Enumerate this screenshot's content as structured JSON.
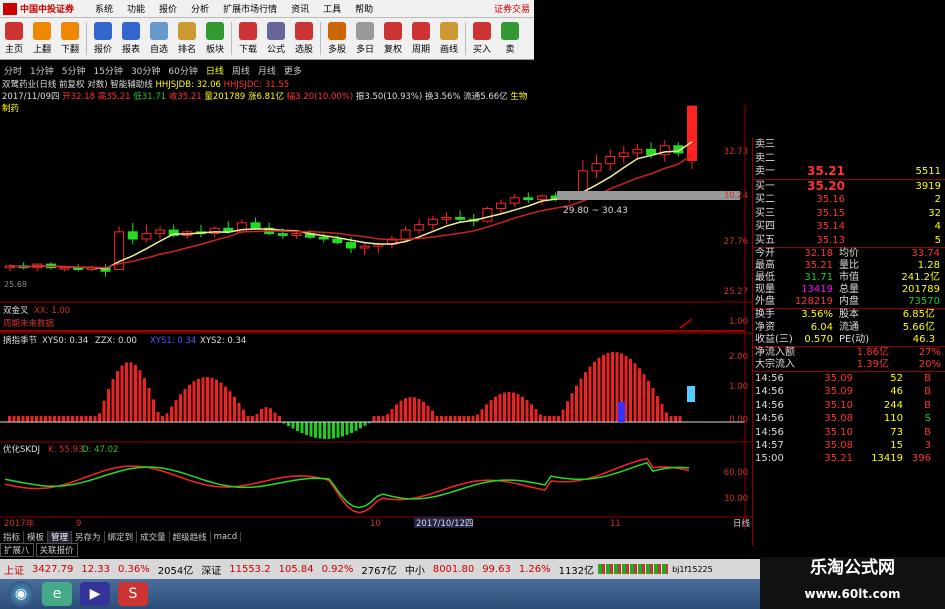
{
  "menu": {
    "brand": "中国中投证券",
    "items": [
      "系统",
      "功能",
      "报价",
      "分析",
      "扩展市场行情",
      "资讯",
      "工具",
      "帮助"
    ],
    "right": "证券交易"
  },
  "toolbar": [
    {
      "label": "主页",
      "icon": "home-icon",
      "color": "#c33"
    },
    {
      "label": "上翻",
      "icon": "up-arrow-icon",
      "color": "#e80"
    },
    {
      "label": "下翻",
      "icon": "down-arrow-icon",
      "color": "#e80"
    },
    {
      "label": "报价",
      "icon": "quote-icon",
      "color": "#36c"
    },
    {
      "label": "报表",
      "icon": "report-icon",
      "color": "#36c"
    },
    {
      "label": "自选",
      "icon": "f6-icon",
      "color": "#69c"
    },
    {
      "label": "排名",
      "icon": "rank-icon",
      "color": "#c93"
    },
    {
      "label": "板块",
      "icon": "sector-icon",
      "color": "#393"
    },
    {
      "label": "下载",
      "icon": "download-icon",
      "color": "#c33"
    },
    {
      "label": "公式",
      "icon": "formula-icon",
      "color": "#669"
    },
    {
      "label": "选股",
      "icon": "stock-pick-icon",
      "color": "#c33"
    },
    {
      "label": "多股",
      "icon": "multi-stock-icon",
      "color": "#c60"
    },
    {
      "label": "多日",
      "icon": "multi-day-icon",
      "color": "#999"
    },
    {
      "label": "复权",
      "icon": "adjust-icon",
      "color": "#c33"
    },
    {
      "label": "周期",
      "icon": "f8-icon",
      "color": "#c33"
    },
    {
      "label": "画线",
      "icon": "draw-icon",
      "color": "#c93"
    },
    {
      "label": "买入",
      "icon": "buy-icon",
      "color": "#c33"
    },
    {
      "label": "卖",
      "icon": "sell-icon",
      "color": "#393"
    }
  ],
  "periods": [
    "分时",
    "1分钟",
    "5分钟",
    "15分钟",
    "30分钟",
    "60分钟",
    "日线",
    "周线",
    "月线",
    "更多"
  ],
  "active_period": "日线",
  "info": {
    "line1_name": "双鹭药业(日线 前复权 对数)",
    "line1_ind": "智能辅助线",
    "line1_a": "HHJSJDB: 32.06",
    "line1_b": "HHJSJDC: 31.55",
    "date": "2017/11/09四",
    "open": "开32.18",
    "high": "高35.21",
    "low": "低31.71",
    "close": "收35.21",
    "vol": "量201789",
    "chg": "涨6.81亿",
    "pct": "幅3.20(10.00%)",
    "amp": "振3.50(10.93%)",
    "turn": "换3.56%",
    "flow": "流通5.66亿",
    "sector": "生物制药"
  },
  "chart": {
    "price_ticks": [
      "32.73",
      "30.24",
      "27.76",
      "25.27"
    ],
    "annotation_box": "29.80 ~ 30.43",
    "low_label": "25.68",
    "sub1": {
      "title": "双金叉",
      "label": "XX: 1.00",
      "note": "周期未来数据",
      "tick": "1.00"
    },
    "sub2": {
      "title": "摘指季节",
      "a": "XYS0: 0.34",
      "b": "ZZX: 0.00",
      "c": "XYS1: 0.34",
      "d": "XYS2: 0.34",
      "ticks": [
        "2.00",
        "1.00",
        "0.00"
      ]
    },
    "sub3": {
      "title": "优化SKDJ",
      "k": "K: 55.93",
      "d": "D: 47.02",
      "ticks": [
        "60.00",
        "30.00"
      ]
    },
    "xaxis": [
      "2017年",
      "9",
      "10",
      "2017/10/12四",
      "11"
    ],
    "period_label": "日线"
  },
  "side": {
    "asks": [
      {
        "label": "卖三",
        "price": "",
        "vol": ""
      },
      {
        "label": "卖二",
        "price": "",
        "vol": ""
      },
      {
        "label": "卖一",
        "price": "35.21",
        "vol": "5511"
      }
    ],
    "bids": [
      {
        "label": "买一",
        "price": "35.20",
        "vol": "3919"
      },
      {
        "label": "买二",
        "price": "35.16",
        "vol": "2"
      },
      {
        "label": "买三",
        "price": "35.15",
        "vol": "32"
      },
      {
        "label": "买四",
        "price": "35.14",
        "vol": "4"
      },
      {
        "label": "买五",
        "price": "35.13",
        "vol": "5"
      }
    ],
    "stats": [
      [
        "今开",
        "32.18",
        "均价",
        "33.74"
      ],
      [
        "最高",
        "35.21",
        "量比",
        "1.28"
      ],
      [
        "最低",
        "31.71",
        "市值",
        "241.2亿"
      ],
      [
        "现量",
        "13419",
        "总量",
        "201789"
      ],
      [
        "外盘",
        "128219",
        "内盘",
        "73570"
      ]
    ],
    "stats2": [
      [
        "换手",
        "3.56%",
        "股本",
        "6.85亿"
      ],
      [
        "净资",
        "6.04",
        "流通",
        "5.66亿"
      ],
      [
        "收益(三)",
        "0.570",
        "PE(动)",
        "46.3"
      ]
    ],
    "flows": [
      [
        "净流入额",
        "1.86亿",
        "27%"
      ],
      [
        "大宗流入",
        "1.39亿",
        "20%"
      ]
    ],
    "ticks": [
      [
        "14:56",
        "35.09",
        "52",
        "B"
      ],
      [
        "14:56",
        "35.09",
        "46",
        "B"
      ],
      [
        "14:56",
        "35.10",
        "244",
        "B"
      ],
      [
        "14:56",
        "35.08",
        "110",
        "S"
      ],
      [
        "14:56",
        "35.10",
        "73",
        "B"
      ],
      [
        "14:57",
        "35.08",
        "15",
        "3"
      ],
      [
        "15:00",
        "35.21",
        "13419",
        "396"
      ]
    ]
  },
  "tabs": [
    "指标",
    "模板",
    "管理",
    "另存为",
    "绑定到",
    "成交量",
    "超级趋线",
    "macd"
  ],
  "tabs2": [
    "扩展八",
    "关联报价"
  ],
  "status": {
    "sh_name": "上证",
    "sh_val": "3427.79",
    "sh_chg": "12.33",
    "sh_pct": "0.36%",
    "sh_amt": "2054亿",
    "sz_name": "深证",
    "sz_val": "11553.2",
    "sz_chg": "105.84",
    "sz_pct": "0.92%",
    "sz_amt": "2767亿",
    "zx_name": "中小",
    "zx_val": "8001.80",
    "zx_chg": "99.63",
    "zx_pct": "1.26%",
    "zx_amt": "1132亿",
    "code": "bj1f15225"
  },
  "watermark": {
    "title": "乐淘公式网",
    "url": "www.60lt.com"
  },
  "chart_data": {
    "type": "candlestick",
    "candles": [
      [
        26.2,
        26.4,
        26.0,
        26.3
      ],
      [
        26.3,
        26.5,
        26.1,
        26.2
      ],
      [
        26.2,
        26.4,
        26.0,
        26.4
      ],
      [
        26.4,
        26.5,
        26.1,
        26.2
      ],
      [
        26.2,
        26.3,
        26.0,
        26.2
      ],
      [
        26.2,
        26.4,
        26.0,
        26.1
      ],
      [
        26.1,
        26.3,
        26.0,
        26.2
      ],
      [
        26.2,
        26.4,
        25.7,
        26.0
      ],
      [
        26.1,
        28.5,
        26.1,
        28.2
      ],
      [
        28.2,
        28.7,
        27.5,
        27.8
      ],
      [
        27.8,
        28.6,
        27.6,
        28.1
      ],
      [
        28.1,
        28.5,
        27.8,
        28.3
      ],
      [
        28.3,
        28.6,
        27.9,
        28.0
      ],
      [
        28.0,
        28.3,
        27.8,
        28.2
      ],
      [
        28.2,
        28.6,
        27.9,
        28.1
      ],
      [
        28.1,
        28.5,
        27.9,
        28.4
      ],
      [
        28.4,
        28.8,
        28.1,
        28.2
      ],
      [
        28.2,
        28.9,
        28.1,
        28.7
      ],
      [
        28.7,
        29.0,
        28.3,
        28.4
      ],
      [
        28.4,
        28.7,
        28.0,
        28.1
      ],
      [
        28.1,
        28.4,
        27.8,
        28.0
      ],
      [
        28.0,
        28.3,
        27.8,
        28.1
      ],
      [
        28.1,
        28.3,
        27.8,
        27.9
      ],
      [
        27.9,
        28.1,
        27.6,
        27.8
      ],
      [
        27.8,
        28.0,
        27.5,
        27.6
      ],
      [
        27.6,
        27.9,
        27.0,
        27.3
      ],
      [
        27.3,
        27.6,
        26.9,
        27.4
      ],
      [
        27.4,
        27.6,
        27.0,
        27.5
      ],
      [
        27.5,
        28.0,
        27.3,
        27.8
      ],
      [
        27.8,
        28.5,
        27.6,
        28.3
      ],
      [
        28.3,
        28.9,
        28.1,
        28.6
      ],
      [
        28.6,
        29.1,
        28.3,
        28.9
      ],
      [
        28.9,
        29.3,
        28.6,
        29.0
      ],
      [
        29.0,
        29.4,
        28.7,
        28.9
      ],
      [
        28.9,
        29.2,
        28.5,
        28.8
      ],
      [
        28.8,
        29.6,
        28.7,
        29.5
      ],
      [
        29.5,
        30.0,
        29.2,
        29.8
      ],
      [
        29.8,
        30.3,
        29.6,
        30.1
      ],
      [
        30.1,
        30.4,
        29.8,
        30.0
      ],
      [
        30.0,
        30.3,
        29.7,
        30.2
      ],
      [
        30.2,
        30.4,
        29.9,
        30.0
      ],
      [
        30.0,
        30.4,
        29.8,
        30.3
      ],
      [
        30.3,
        32.2,
        30.1,
        31.6
      ],
      [
        31.6,
        32.5,
        31.2,
        32.0
      ],
      [
        32.0,
        32.8,
        31.6,
        32.4
      ],
      [
        32.4,
        33.0,
        32.0,
        32.6
      ],
      [
        32.6,
        33.1,
        32.2,
        32.8
      ],
      [
        32.8,
        33.2,
        32.3,
        32.5
      ],
      [
        32.5,
        33.3,
        32.1,
        33.0
      ],
      [
        33.0,
        33.2,
        32.4,
        32.6
      ],
      [
        32.18,
        35.21,
        31.71,
        35.21
      ]
    ]
  }
}
